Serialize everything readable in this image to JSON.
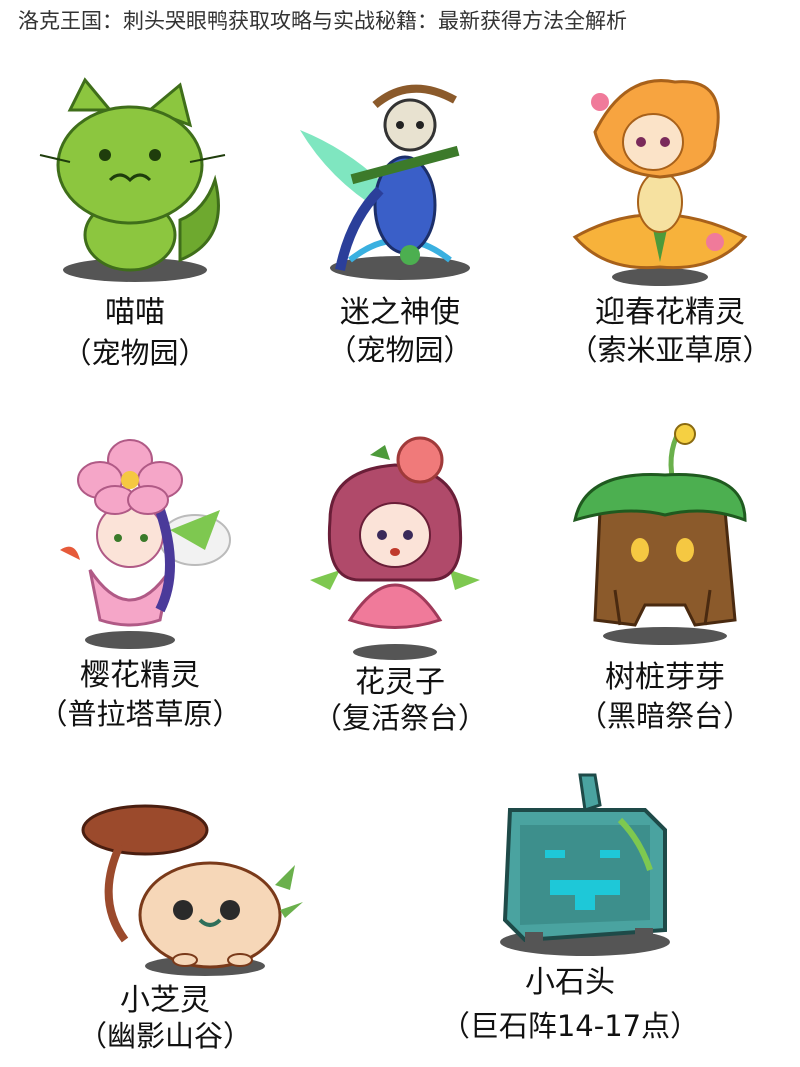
{
  "title": "洛克王国：刺头哭眼鸭获取攻略与实战秘籍：最新获得方法全解析",
  "pets": [
    {
      "name": "喵喵",
      "location": "（宠物园）",
      "icon": "green-cat-pet"
    },
    {
      "name": "迷之神使",
      "location": "（宠物园）",
      "icon": "mystery-envoy-pet"
    },
    {
      "name": "迎春花精灵",
      "location": "（索米亚草原）",
      "icon": "spring-flower-pet"
    },
    {
      "name": "樱花精灵",
      "location": "（普拉塔草原）",
      "icon": "cherry-blossom-pet"
    },
    {
      "name": "花灵子",
      "location": "（复活祭台）",
      "icon": "flower-girl-pet"
    },
    {
      "name": "树桩芽芽",
      "location": "（黑暗祭台）",
      "icon": "tree-stump-pet"
    },
    {
      "name": "小芝灵",
      "location": "（幽影山谷）",
      "icon": "mushroom-pet"
    },
    {
      "name": "小石头",
      "location": "（巨石阵14-17点）",
      "icon": "stone-block-pet"
    }
  ],
  "colors": {
    "shadow": "#555555",
    "cat_green": "#8cc63f",
    "envoy_blue": "#3a5fc8",
    "spring_orange": "#f7a440",
    "cherry_pink": "#f5a6c8",
    "flower_red": "#d9534f",
    "stump_brown": "#8b5a2b",
    "mushroom_brown": "#9b4a2c",
    "stone_teal": "#4aa3a0"
  }
}
